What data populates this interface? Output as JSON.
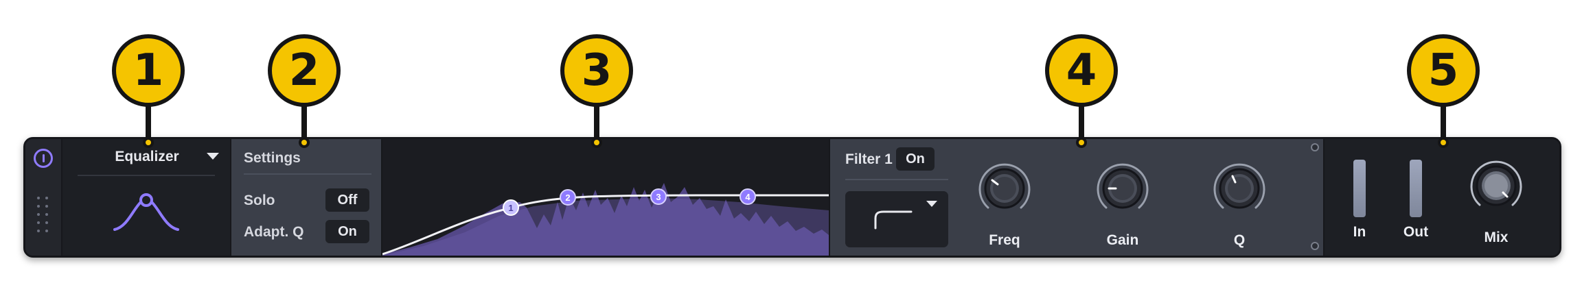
{
  "callouts": [
    "1",
    "2",
    "3",
    "4",
    "5"
  ],
  "module": {
    "name": "Equalizer",
    "icon": "bell-curve-icon",
    "dropdown_icon": "chevron-down-icon"
  },
  "settings": {
    "title": "Settings",
    "solo_label": "Solo",
    "solo_value": "Off",
    "adapt_label": "Adapt. Q",
    "adapt_value": "On"
  },
  "graph": {
    "nodes": [
      "1",
      "2",
      "3",
      "4"
    ]
  },
  "filter": {
    "label": "Filter 1",
    "state": "On",
    "shape_icon": "low-shelf-icon",
    "knobs": [
      {
        "label": "Freq",
        "icon": "knob-icon"
      },
      {
        "label": "Gain",
        "icon": "knob-icon"
      },
      {
        "label": "Q",
        "icon": "knob-icon"
      }
    ]
  },
  "output": {
    "in_label": "In",
    "out_label": "Out",
    "mix_label": "Mix"
  },
  "colors": {
    "accent": "#8f7bff",
    "callout": "#f5c400",
    "panel_dark": "#1d1f24",
    "panel_mid": "#3a3e48"
  }
}
